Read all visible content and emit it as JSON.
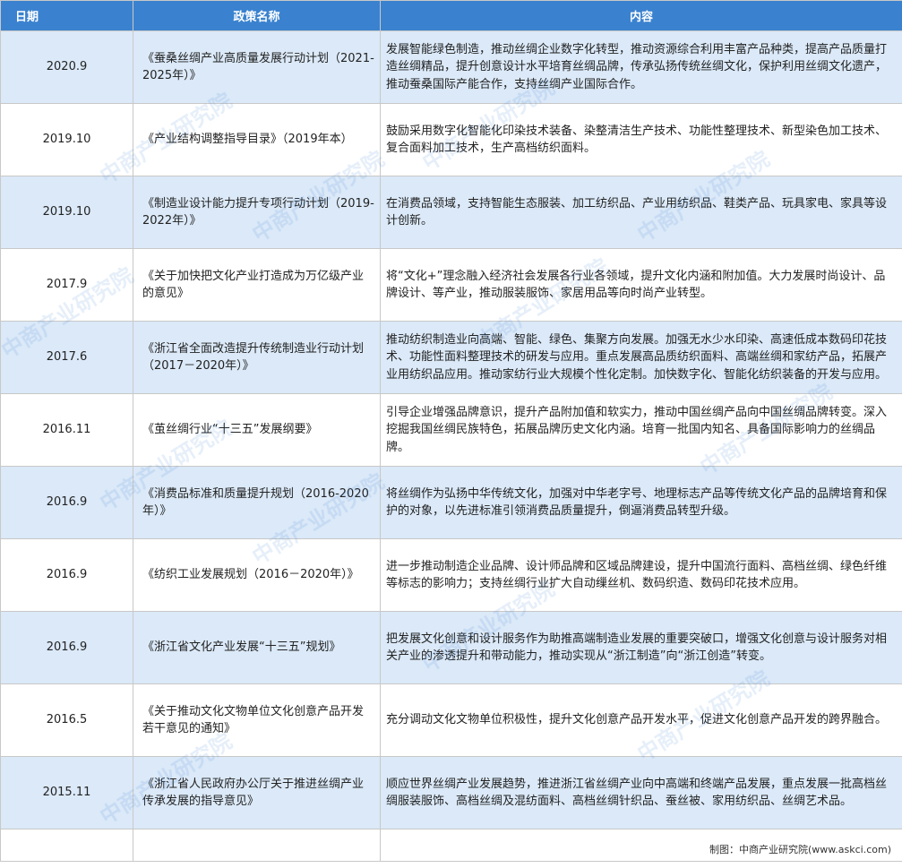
{
  "header": {
    "date": "日期",
    "name": "政策名称",
    "content": "内容"
  },
  "rows": [
    {
      "date": "2020.9",
      "name": "《蚕桑丝绸产业高质量发展行动计划（2021-2025年）》",
      "content": "发展智能绿色制造，推动丝绸企业数字化转型，推动资源综合利用丰富产品种类，提高产品质量打造丝绸精品，提升创意设计水平培育丝绸品牌，传承弘扬传统丝绸文化，保护利用丝绸文化遗产，推动蚕桑国际产能合作，支持丝绸产业国际合作。"
    },
    {
      "date": "2019.10",
      "name": "《产业结构调整指导目录》（2019年本）",
      "content": "鼓励采用数字化智能化印染技术装备、染整清洁生产技术、功能性整理技术、新型染色加工技术、复合面料加工技术，生产高档纺织面料。"
    },
    {
      "date": "2019.10",
      "name": "《制造业设计能力提升专项行动计划（2019-2022年）》",
      "content": "在消费品领域，支持智能生态服装、加工纺织品、产业用纺织品、鞋类产品、玩具家电、家具等设计创新。"
    },
    {
      "date": "2017.9",
      "name": "《关于加快把文化产业打造成为万亿级产业的意见》",
      "content": "将“文化+”理念融入经济社会发展各行业各领域，提升文化内涵和附加值。大力发展时尚设计、品牌设计、等产业，推动服装服饰、家居用品等向时尚产业转型。"
    },
    {
      "date": "2017.6",
      "name": "《浙江省全面改造提升传统制造业行动计划（2017－2020年）》",
      "content": "推动纺织制造业向高端、智能、绿色、集聚方向发展。加强无水少水印染、高速低成本数码印花技术、功能性面料整理技术的研发与应用。重点发展高品质纺织面料、高端丝绸和家纺产品，拓展产业用纺织品应用。推动家纺行业大规模个性化定制。加快数字化、智能化纺织装备的开发与应用。"
    },
    {
      "date": "2016.11",
      "name": "《茧丝绸行业“十三五”发展纲要》",
      "content": "引导企业增强品牌意识，提升产品附加值和软实力，推动中国丝绸产品向中国丝绸品牌转变。深入挖掘我国丝绸民族特色，拓展品牌历史文化内涵。培育一批国内知名、具备国际影响力的丝绸品牌。"
    },
    {
      "date": "2016.9",
      "name": "《消费品标准和质量提升规划（2016-2020年）》",
      "content": "将丝绸作为弘扬中华传统文化，加强对中华老字号、地理标志产品等传统文化产品的品牌培育和保护的对象，以先进标准引领消费品质量提升，倒逼消费品转型升级。"
    },
    {
      "date": "2016.9",
      "name": "《纺织工业发展规划（2016－2020年）》",
      "content": "进一步推动制造企业品牌、设计师品牌和区域品牌建设，提升中国流行面料、高档丝绸、绿色纤维等标志的影响力；支持丝绸行业扩大自动缫丝机、数码织造、数码印花技术应用。"
    },
    {
      "date": "2016.9",
      "name": "《浙江省文化产业发展“十三五”规划》",
      "content": "把发展文化创意和设计服务作为助推高端制造业发展的重要突破口，增强文化创意与设计服务对相关产业的渗透提升和带动能力，推动实现从“浙江制造”向“浙江创造”转变。"
    },
    {
      "date": "2016.5",
      "name": "《关于推动文化文物单位文化创意产品开发若干意见的通知》",
      "content": "充分调动文化文物单位积极性，提升文化创意产品开发水平，促进文化创意产品开发的跨界融合。"
    },
    {
      "date": "2015.11",
      "name": "《浙江省人民政府办公厅关于推进丝绸产业传承发展的指导意见》",
      "content": "顺应世界丝绸产业发展趋势，推进浙江省丝绸产业向中高端和终端产品发展，重点发展一批高档丝绸服装服饰、高档丝绸及混纺面料、高档丝绸针织品、蚕丝被、家用纺织品、丝绸艺术品。"
    }
  ],
  "footer": {
    "source": "制图：中商产业研究院(www.askci.com)"
  },
  "watermark": {
    "text": "中商产业研究院"
  },
  "colors": {
    "header_bg": "#3a82cf",
    "row_alt_bg": "#dbe9f8",
    "border": "#c8c8c8"
  }
}
